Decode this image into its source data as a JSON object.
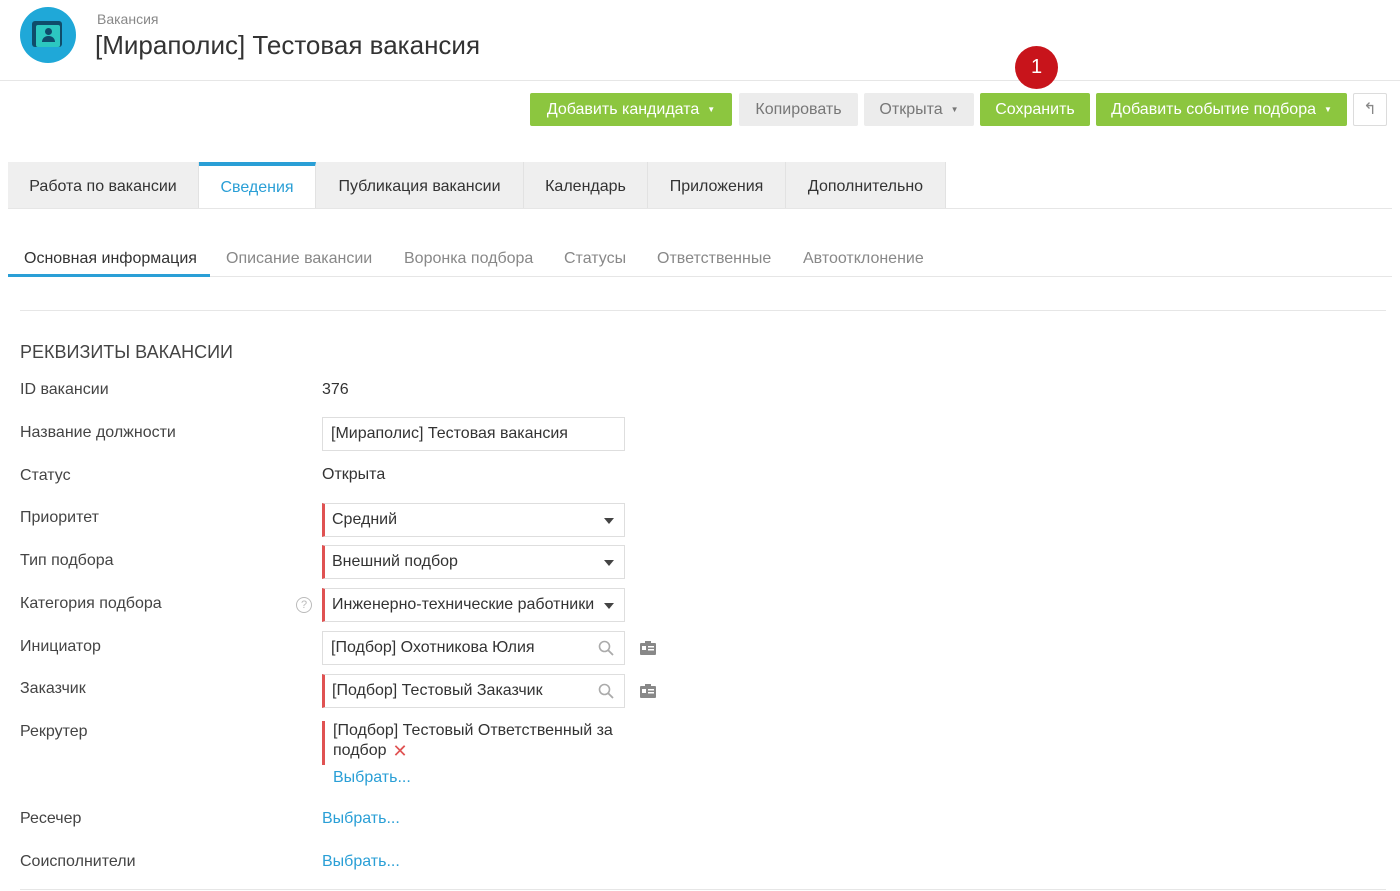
{
  "header": {
    "breadcrumb": "Вакансия",
    "title": "[Мираполис] Тестовая вакансия"
  },
  "annotation_badge": "1",
  "toolbar": {
    "add_candidate": "Добавить кандидата",
    "copy": "Копировать",
    "status": "Открыта",
    "save": "Сохранить",
    "add_event": "Добавить событие подбора",
    "caret": "▼",
    "back_icon": "↰"
  },
  "tabs": [
    {
      "label": "Работа по вакансии"
    },
    {
      "label": "Сведения"
    },
    {
      "label": "Публикация вакансии"
    },
    {
      "label": "Календарь"
    },
    {
      "label": "Приложения"
    },
    {
      "label": "Дополнительно"
    }
  ],
  "subtabs": [
    {
      "label": "Основная информация"
    },
    {
      "label": "Описание вакансии"
    },
    {
      "label": "Воронка подбора"
    },
    {
      "label": "Статусы"
    },
    {
      "label": "Ответственные"
    },
    {
      "label": "Автоотклонение"
    }
  ],
  "section": {
    "title": "РЕКВИЗИТЫ ВАКАНСИИ"
  },
  "fields": {
    "id_label": "ID вакансии",
    "id_value": "376",
    "name_label": "Название должности",
    "name_value": "[Мираполис] Тестовая вакансия",
    "status_label": "Статус",
    "status_value": "Открыта",
    "priority_label": "Приоритет",
    "priority_value": "Средний",
    "type_label": "Тип подбора",
    "type_value": "Внешний подбор",
    "category_label": "Категория подбора",
    "category_value": "Инженерно-технические работники",
    "category_help": "?",
    "initiator_label": "Инициатор",
    "initiator_value": "[Подбор] Охотникова Юлия",
    "customer_label": "Заказчик",
    "customer_value": "[Подбор] Тестовый Заказчик",
    "recruiter_label": "Рекрутер",
    "recruiter_value": "[Подбор] Тестовый Ответственный за подбор",
    "recruiter_remove": "✕",
    "choose": "Выбрать...",
    "researcher_label": "Ресечер",
    "coexecutors_label": "Соисполнители"
  },
  "colors": {
    "accent_green": "#8cc63f",
    "accent_blue": "#2a9fd6",
    "required_red": "#e05252",
    "badge_red": "#c8141b"
  }
}
